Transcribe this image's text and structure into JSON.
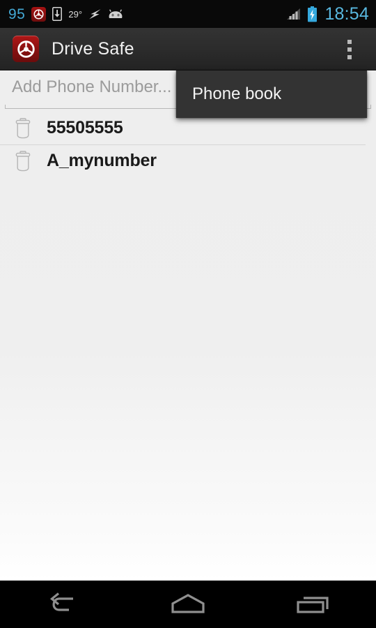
{
  "status_bar": {
    "battery_percent": "95",
    "temperature": "29°",
    "clock": "18:54",
    "icons": {
      "app_notification": "drive-safe-steering-wheel-icon",
      "download": "download-icon",
      "charging": "lightning-bolt-icon",
      "android": "android-head-icon",
      "signal": "signal-bars-icon",
      "battery": "battery-charging-icon"
    },
    "colors": {
      "battery_number": "#44a8d4",
      "clock": "#59b8e0",
      "background": "#090909"
    }
  },
  "action_bar": {
    "app_icon": "steering-wheel-icon",
    "title": "Drive Safe",
    "overflow": "overflow-menu-icon",
    "accent_red": "#8e1111"
  },
  "overflow_menu": {
    "open": true,
    "items": [
      {
        "label": "Phone book"
      }
    ]
  },
  "main": {
    "input": {
      "placeholder": "Add Phone Number...",
      "value": ""
    },
    "list": [
      {
        "delete_icon": "trash-icon",
        "label": "55505555"
      },
      {
        "delete_icon": "trash-icon",
        "label": "A_mynumber"
      }
    ]
  },
  "nav_bar": {
    "buttons": [
      {
        "name": "back",
        "icon": "back-arrow-icon"
      },
      {
        "name": "home",
        "icon": "home-icon"
      },
      {
        "name": "recents",
        "icon": "recents-icon"
      }
    ],
    "icon_color": "#8f8f8f"
  }
}
